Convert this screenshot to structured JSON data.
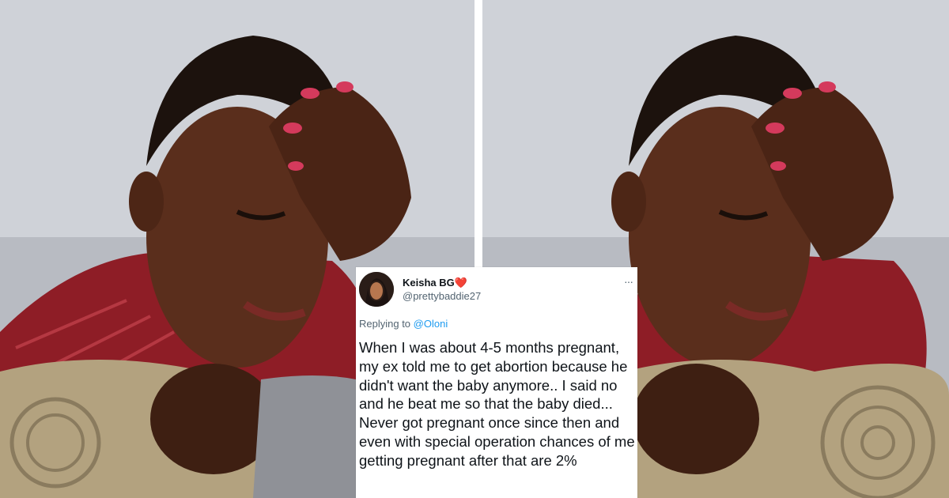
{
  "tweet": {
    "display_name": "Keisha BG",
    "badge_icon": "heart-emoji-icon",
    "handle": "@prettybaddie27",
    "replying_prefix": "Replying to",
    "replying_to": "@Oloni",
    "more_icon": "more-options-icon",
    "text": "When I was about 4-5 months pregnant, my ex told me to get abortion because he didn't want the baby anymore.. I said no and he beat me so that the baby died... Never got pregnant once since then and even with  special operation chances of me getting pregnant after that are 2%"
  },
  "colors": {
    "accent_link": "#1d9bf0",
    "secondary_text": "#536471",
    "primary_text": "#0f1419",
    "heart": "#e5324b"
  }
}
